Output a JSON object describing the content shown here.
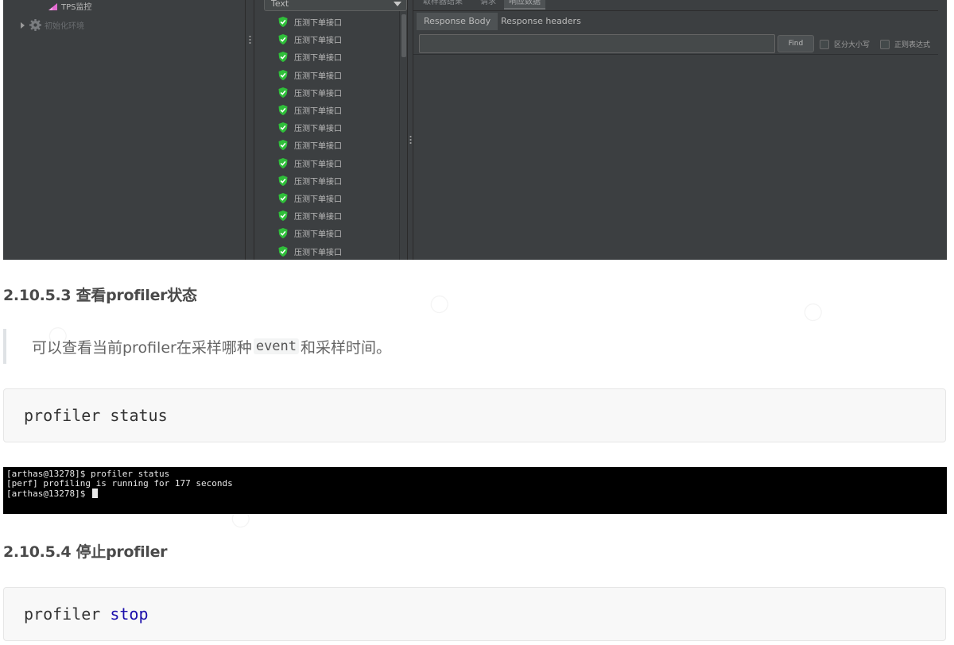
{
  "jmeter": {
    "tree": [
      {
        "label": "TPS监控",
        "icon": "chart-icon",
        "dim": false
      },
      {
        "label": "初始化环境",
        "icon": "gear-icon",
        "dim": true
      }
    ],
    "view_mode": "Text",
    "request_label": "压测下单接口",
    "request_count": 14,
    "top_tabs": [
      "取样器结果",
      "请求",
      "响应数据"
    ],
    "sub_tabs": [
      "Response Body",
      "Response headers"
    ],
    "find_label": "Find",
    "case_sensitive_label": "区分大小写",
    "regex_label": "正则表达式",
    "accent": "#3c3f41"
  },
  "doc": {
    "h3": "2.10.5.3 查看profiler状态",
    "quote_before": "可以查看当前profiler在采样哪种",
    "quote_code": "event",
    "quote_after": "和采样时间。",
    "code1": "profiler status",
    "terminal": [
      "[arthas@13278]$ profiler status",
      "[perf] profiling is running for 177 seconds",
      "[arthas@13278]$ "
    ],
    "h4": "2.10.5.4 停止profiler",
    "code2_cmd": "profiler",
    "code2_kw": "stop"
  }
}
